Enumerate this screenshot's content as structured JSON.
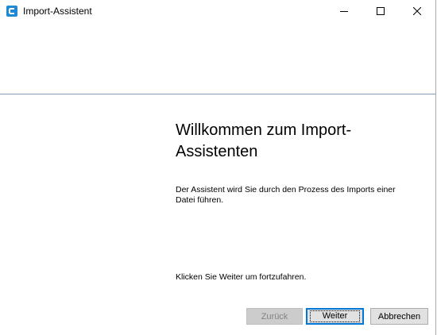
{
  "window": {
    "title": "Import-Assistent",
    "controls": {
      "minimize_icon": "minimize-icon",
      "maximize_icon": "maximize-icon",
      "close_icon": "close-icon"
    }
  },
  "content": {
    "heading": "Willkommen zum Import-Assistenten",
    "description": "Der Assistent wird Sie durch den Prozess des Imports einer Datei führen.",
    "continue_hint": "Klicken Sie Weiter um fortzufahren."
  },
  "buttons": {
    "back": "Zurück",
    "next": "Weiter",
    "cancel": "Abbrechen"
  },
  "colors": {
    "accent": "#0078d7",
    "app_icon": "#1e8ad6",
    "separator": "#7f9db9",
    "disabled_text": "#838383"
  }
}
